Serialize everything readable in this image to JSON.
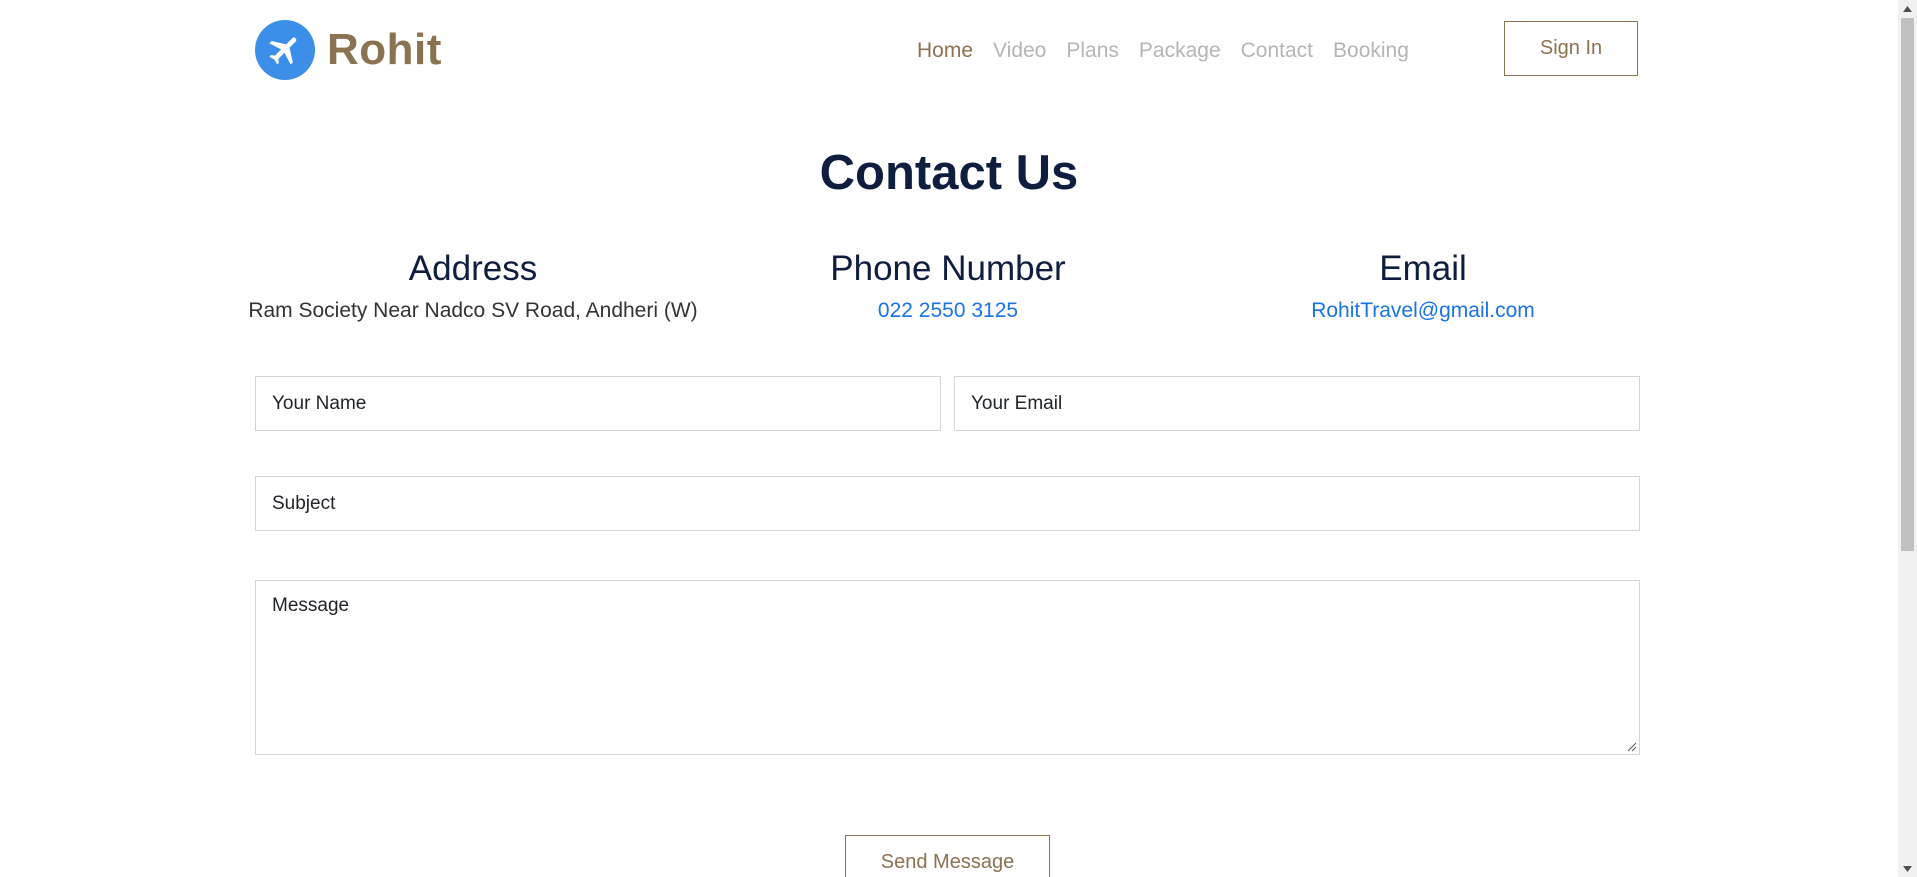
{
  "brand": {
    "name": "Rohit",
    "icon": "airplane-icon"
  },
  "nav": {
    "items": [
      "Home",
      "Video",
      "Plans",
      "Package",
      "Contact",
      "Booking"
    ],
    "active": "Home"
  },
  "signin_label": "Sign In",
  "page_title": "Contact Us",
  "contact_info": {
    "address": {
      "heading": "Address",
      "value": "Ram Society Near Nadco SV Road, Andheri (W)"
    },
    "phone": {
      "heading": "Phone Number",
      "value": "022 2550 3125"
    },
    "email": {
      "heading": "Email",
      "value": "RohitTravel@gmail.com"
    }
  },
  "form": {
    "name_placeholder": "Your Name",
    "email_placeholder": "Your Email",
    "subject_placeholder": "Subject",
    "message_placeholder": "Message",
    "submit_label": "Send Message"
  },
  "colors": {
    "brand": "#8b7250",
    "heading": "#0f1d3f",
    "link": "#1a73e8",
    "logo_circle": "#3b8fe8"
  }
}
